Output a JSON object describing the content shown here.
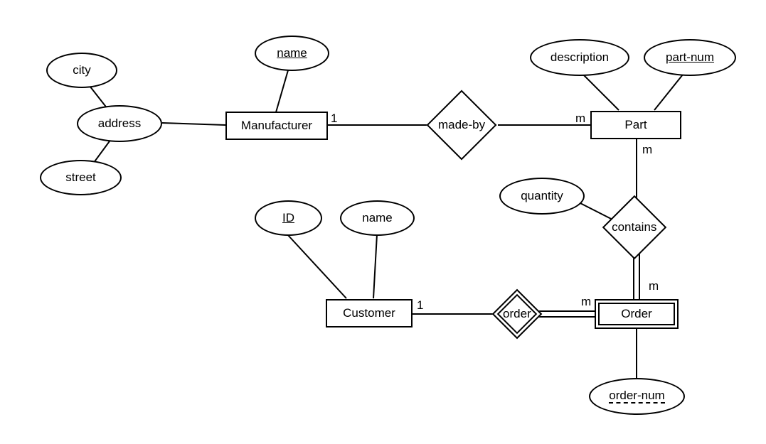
{
  "entities": {
    "manufacturer": "Manufacturer",
    "part": "Part",
    "customer": "Customer",
    "order": "Order"
  },
  "relationships": {
    "made_by": "made-by",
    "contains": "contains",
    "order_rel": "order"
  },
  "attributes": {
    "city": "city",
    "address": "address",
    "street": "street",
    "mfr_name": "name",
    "description": "description",
    "part_num": "part-num",
    "quantity": "quantity",
    "cust_id": "ID",
    "cust_name": "name",
    "order_num": "order-num"
  },
  "cardinalities": {
    "mfr_madeby": "1",
    "part_madeby": "m",
    "part_contains": "m",
    "order_contains": "m",
    "customer_order": "1",
    "order_order": "m"
  }
}
